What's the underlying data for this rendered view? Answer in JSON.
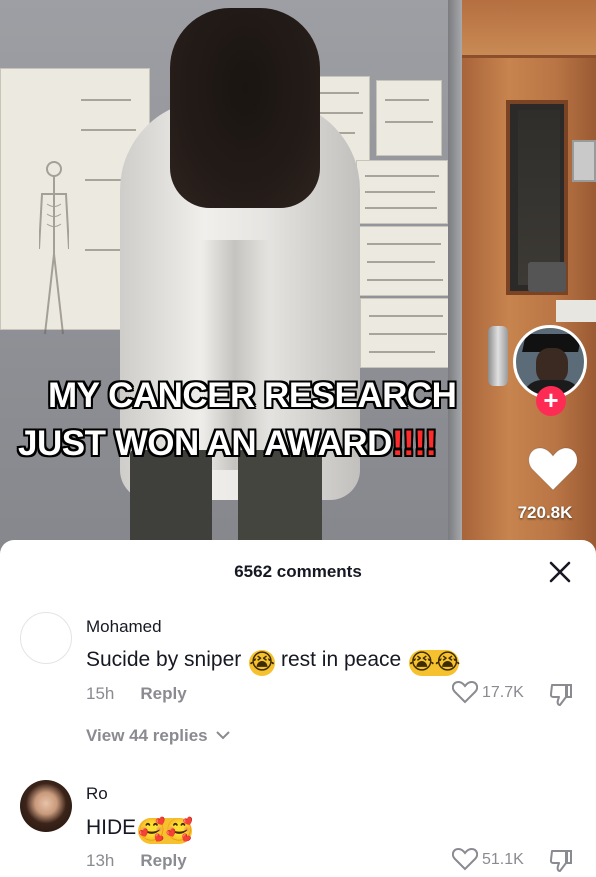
{
  "video": {
    "caption_line1": "MY CANCER RESEARCH",
    "caption_line2": "JUST WON AN AWARD",
    "caption_emphasis": "!!!!",
    "follow_symbol": "+",
    "like_count": "720.8K",
    "icons": [
      "creator-avatar",
      "follow-plus-icon",
      "heart-icon"
    ]
  },
  "comments_panel": {
    "count_label": "6562 comments",
    "close_icon": "close-icon",
    "comments": [
      {
        "username": "Mohamed",
        "text_part1": "Sucide by sniper",
        "emoji1": "😭",
        "text_part2": "rest in peace",
        "emoji2": "😭😭",
        "time": "15h",
        "reply_label": "Reply",
        "likes": "17.7K",
        "view_replies": "View 44 replies",
        "view_replies_icon": "chevron-down-icon"
      },
      {
        "username": "Ro",
        "text_part1": "HIDE",
        "emoji1": "🥰🥰",
        "time": "13h",
        "reply_label": "Reply",
        "likes": "51.1K"
      }
    ]
  },
  "colors": {
    "accent_red": "#fe2c55",
    "text_primary": "#161823",
    "text_secondary": "#8a8b91"
  }
}
